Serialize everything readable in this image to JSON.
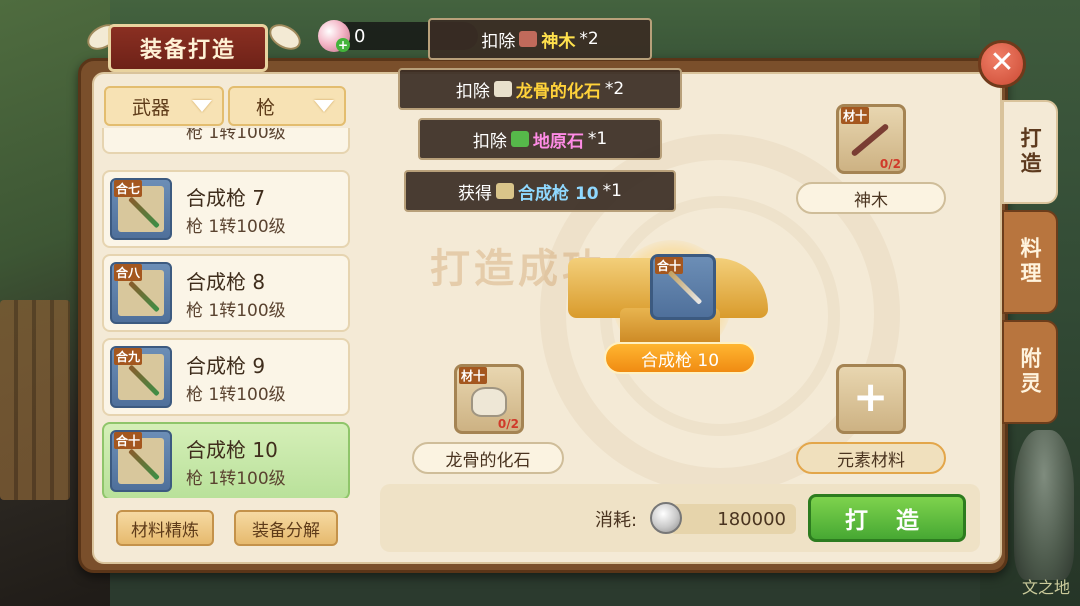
{
  "title": "装备打造",
  "currency": {
    "amount": "0"
  },
  "filters": {
    "category": "武器",
    "subtype": "枪"
  },
  "list": {
    "partial_item": {
      "sub": "枪 1转100级"
    },
    "items": [
      {
        "name": "合成枪  7",
        "sub": "枪 1转100级",
        "tag": "合七"
      },
      {
        "name": "合成枪  8",
        "sub": "枪 1转100级",
        "tag": "合八"
      },
      {
        "name": "合成枪  9",
        "sub": "枪 1转100级",
        "tag": "合九"
      },
      {
        "name": "合成枪  10",
        "sub": "枪 1转100级",
        "tag": "合十"
      }
    ]
  },
  "buttons": {
    "refine": "材料精炼",
    "decompose": "装备分解",
    "forge": "打 造"
  },
  "side_tabs": [
    "打造",
    "料理",
    "附灵"
  ],
  "craft": {
    "ghost_text": "打造成功",
    "result_label": "合成枪  10",
    "result_tag": "合十",
    "material_top": {
      "name": "神木",
      "tag": "材十",
      "count": "0/2"
    },
    "material_left": {
      "name": "龙骨的化石",
      "tag": "材十",
      "count": "0/2"
    },
    "material_right": {
      "name": "元素材料"
    }
  },
  "notifications": [
    {
      "prefix": "扣除",
      "item": "神木",
      "suffix": "*2",
      "color": "#ffe14d"
    },
    {
      "prefix": "扣除",
      "item": "龙骨的化石",
      "suffix": "*2",
      "color": "#ffd23a"
    },
    {
      "prefix": "扣除",
      "item": "地原石",
      "suffix": "*1",
      "color": "#ff8ce6"
    },
    {
      "prefix": "获得",
      "item": "合成枪  10",
      "suffix": "*1",
      "color": "#8fd8ff"
    }
  ],
  "cost": {
    "label": "消耗:",
    "value": "180000"
  },
  "watermark": "文之地",
  "colors": {
    "panel": "#7a4f2b",
    "parchment": "#f4ead6",
    "selected": "#b9e19a",
    "forge": "#47a833"
  }
}
